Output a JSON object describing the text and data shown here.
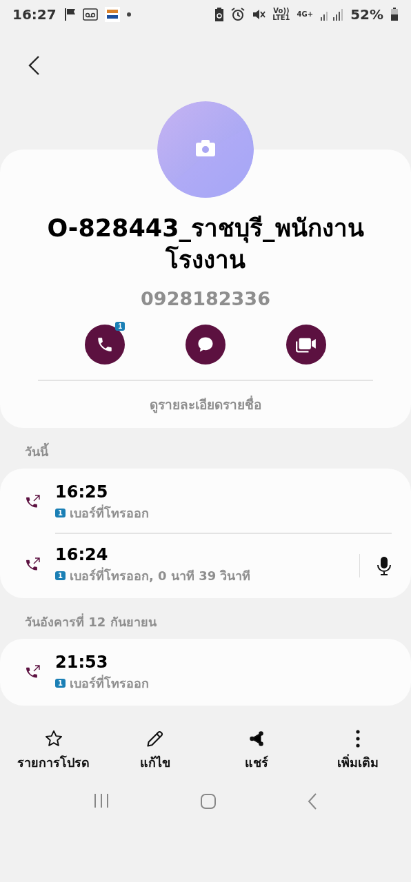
{
  "status_bar": {
    "time": "16:27",
    "voice": "Vo))",
    "lte": "LTE1",
    "network_type": "4G+",
    "battery": "52%"
  },
  "contact": {
    "name": "O-828443_ราชบุรี_พนักงานโรงงาน",
    "phone": "0928182336",
    "details_link": "ดูรายละเอียดรายชื่อ"
  },
  "actions": [
    {
      "kind": "call",
      "badge": "1"
    },
    {
      "kind": "message"
    },
    {
      "kind": "video"
    }
  ],
  "call_groups": [
    {
      "date": "วันนี้",
      "calls": [
        {
          "time": "16:25",
          "sim": "1",
          "detail": "เบอร์ที่โทรออก",
          "recording": false
        },
        {
          "time": "16:24",
          "sim": "1",
          "detail": "เบอร์ที่โทรออก, 0 นาที 39 วินาที",
          "recording": true
        }
      ]
    },
    {
      "date": "วันอังคารที่ 12 กันยายน",
      "calls": [
        {
          "time": "21:53",
          "sim": "1",
          "detail": "เบอร์ที่โทรออก",
          "recording": false
        }
      ]
    }
  ],
  "bottom_actions": [
    {
      "kind": "favorite",
      "label": "รายการโปรด"
    },
    {
      "kind": "edit",
      "label": "แก้ไข"
    },
    {
      "kind": "share",
      "label": "แชร์"
    },
    {
      "kind": "more",
      "label": "เพิ่มเติม"
    }
  ]
}
